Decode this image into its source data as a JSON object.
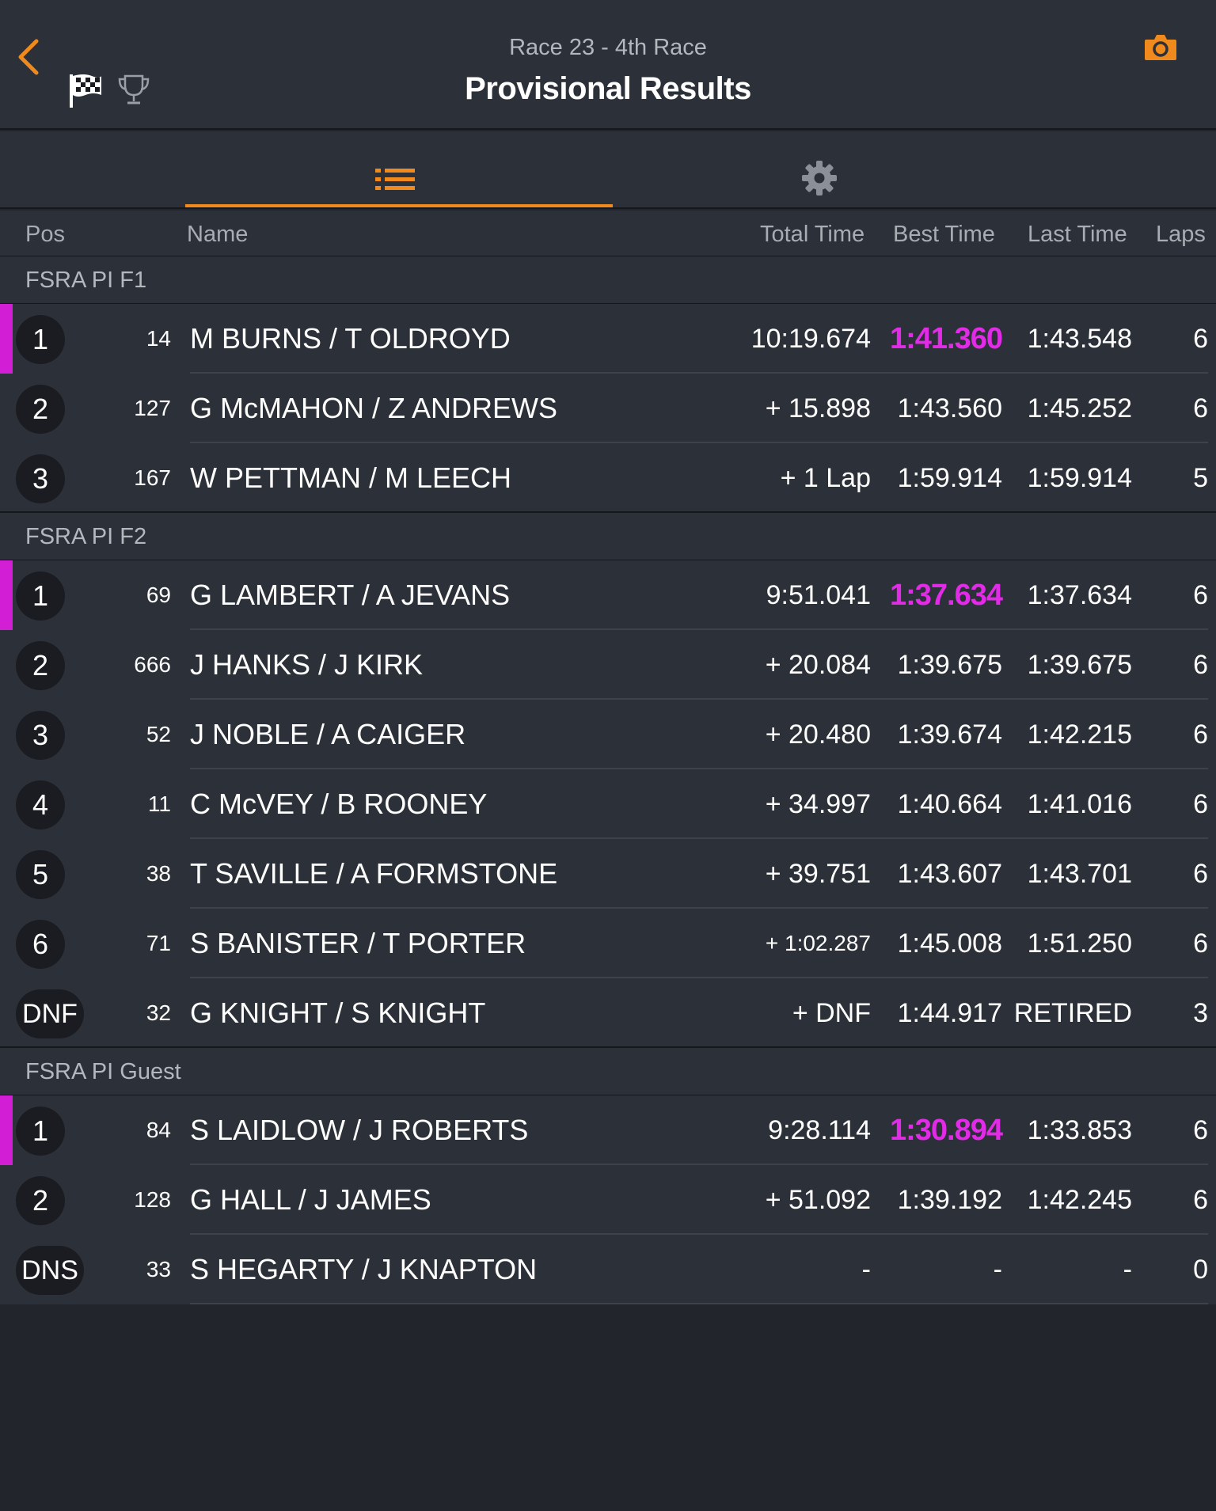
{
  "header": {
    "subtitle": "Race 23 - 4th Race",
    "title": "Provisional Results"
  },
  "icons": {
    "back": "chevron-left-icon",
    "flag": "checkered-flag-icon",
    "trophy": "trophy-icon",
    "camera": "camera-icon",
    "list": "list-icon",
    "settings": "gear-icon"
  },
  "colors": {
    "accent": "#f08a1c",
    "fastest": "#e22be6",
    "background": "#2c3038"
  },
  "columns": {
    "pos": "Pos",
    "name": "Name",
    "total": "Total Time",
    "best": "Best Time",
    "last": "Last Time",
    "laps": "Laps"
  },
  "groups": [
    {
      "name": "FSRA PI F1",
      "rows": [
        {
          "pos": "1",
          "num": "14",
          "name": "M BURNS / T OLDROYD",
          "total": "10:19.674",
          "best": "1:41.360",
          "last": "1:43.548",
          "laps": "6",
          "fastest": true
        },
        {
          "pos": "2",
          "num": "127",
          "name": "G McMAHON / Z ANDREWS",
          "total": "+ 15.898",
          "best": "1:43.560",
          "last": "1:45.252",
          "laps": "6"
        },
        {
          "pos": "3",
          "num": "167",
          "name": "W PETTMAN / M LEECH",
          "total": "+ 1 Lap",
          "best": "1:59.914",
          "last": "1:59.914",
          "laps": "5"
        }
      ]
    },
    {
      "name": "FSRA PI F2",
      "rows": [
        {
          "pos": "1",
          "num": "69",
          "name": "G LAMBERT / A JEVANS",
          "total": "9:51.041",
          "best": "1:37.634",
          "last": "1:37.634",
          "laps": "6",
          "fastest": true
        },
        {
          "pos": "2",
          "num": "666",
          "name": "J HANKS / J KIRK",
          "total": "+ 20.084",
          "best": "1:39.675",
          "last": "1:39.675",
          "laps": "6"
        },
        {
          "pos": "3",
          "num": "52",
          "name": "J NOBLE / A CAIGER",
          "total": "+ 20.480",
          "best": "1:39.674",
          "last": "1:42.215",
          "laps": "6"
        },
        {
          "pos": "4",
          "num": "11",
          "name": "C McVEY / B ROONEY",
          "total": "+ 34.997",
          "best": "1:40.664",
          "last": "1:41.016",
          "laps": "6"
        },
        {
          "pos": "5",
          "num": "38",
          "name": "T SAVILLE / A FORMSTONE",
          "total": "+ 39.751",
          "best": "1:43.607",
          "last": "1:43.701",
          "laps": "6"
        },
        {
          "pos": "6",
          "num": "71",
          "name": "S BANISTER / T PORTER",
          "total": "+ 1:02.287",
          "best": "1:45.008",
          "last": "1:51.250",
          "laps": "6",
          "small_total": true
        },
        {
          "pos": "DNF",
          "num": "32",
          "name": "G KNIGHT / S KNIGHT",
          "total": "+ DNF",
          "best": "1:44.917",
          "last": "RETIRED",
          "laps": "3"
        }
      ]
    },
    {
      "name": "FSRA PI Guest",
      "rows": [
        {
          "pos": "1",
          "num": "84",
          "name": "S LAIDLOW / J ROBERTS",
          "total": "9:28.114",
          "best": "1:30.894",
          "last": "1:33.853",
          "laps": "6",
          "fastest": true
        },
        {
          "pos": "2",
          "num": "128",
          "name": "G HALL / J JAMES",
          "total": "+ 51.092",
          "best": "1:39.192",
          "last": "1:42.245",
          "laps": "6"
        },
        {
          "pos": "DNS",
          "num": "33",
          "name": "S HEGARTY / J KNAPTON",
          "total": "-",
          "best": "-",
          "last": "-",
          "laps": "0"
        }
      ]
    }
  ]
}
